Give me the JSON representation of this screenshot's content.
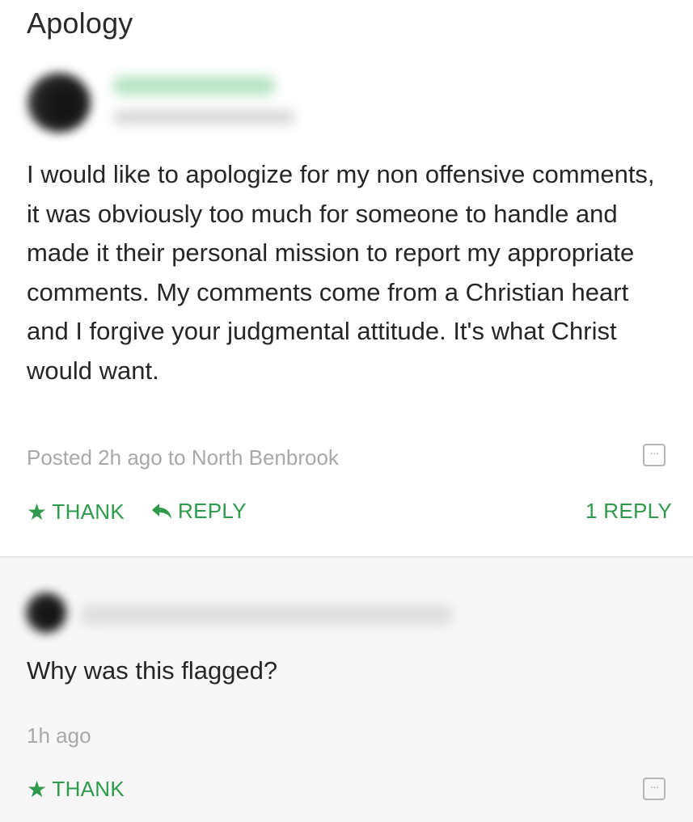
{
  "post": {
    "title": "Apology",
    "body": "I would like to apologize for my non offensive comments, it was obviously too much for someone to handle and made it their personal mission to report my appropriate comments. My comments come from a Christian heart and I forgive your judgmental attitude. It's what Christ would want.",
    "meta": "Posted 2h ago to North Benbrook",
    "more_icon": "more-options-icon",
    "actions": {
      "thank_label": "THANK",
      "reply_label": "REPLY",
      "replies_count_label": "1 REPLY"
    }
  },
  "reply": {
    "text": "Why was this flagged?",
    "time": "1h ago",
    "thank_label": "THANK"
  },
  "colors": {
    "accent_green": "#2e9a4b",
    "meta_gray": "#a8a8a8",
    "reply_background": "#f7f7f7"
  }
}
